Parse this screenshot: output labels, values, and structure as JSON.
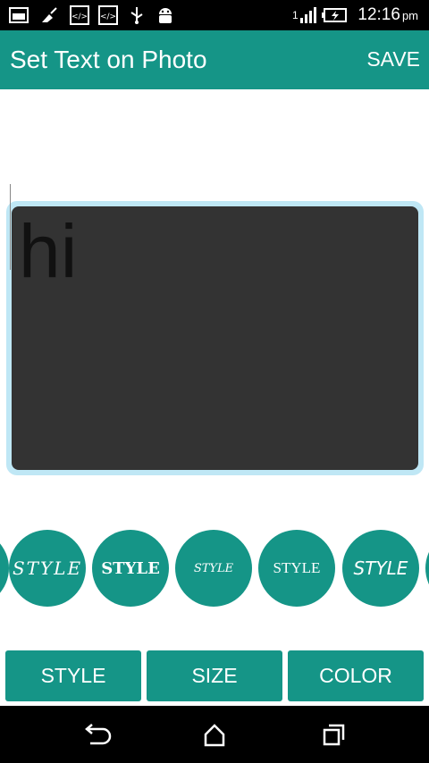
{
  "status_bar": {
    "time": "12:16",
    "ampm": "pm",
    "signal_label": "1"
  },
  "app_bar": {
    "title": "Set Text on Photo",
    "save_label": "SAVE"
  },
  "canvas": {
    "text": "hi"
  },
  "style_options": [
    "STYLE",
    "STYLE",
    "STYLE",
    "STYLE",
    "STYLE"
  ],
  "tabs": [
    "STYLE",
    "SIZE",
    "COLOR"
  ],
  "colors": {
    "primary": "#159587",
    "canvas_bg": "#333333",
    "frame": "#bfe7f5"
  }
}
